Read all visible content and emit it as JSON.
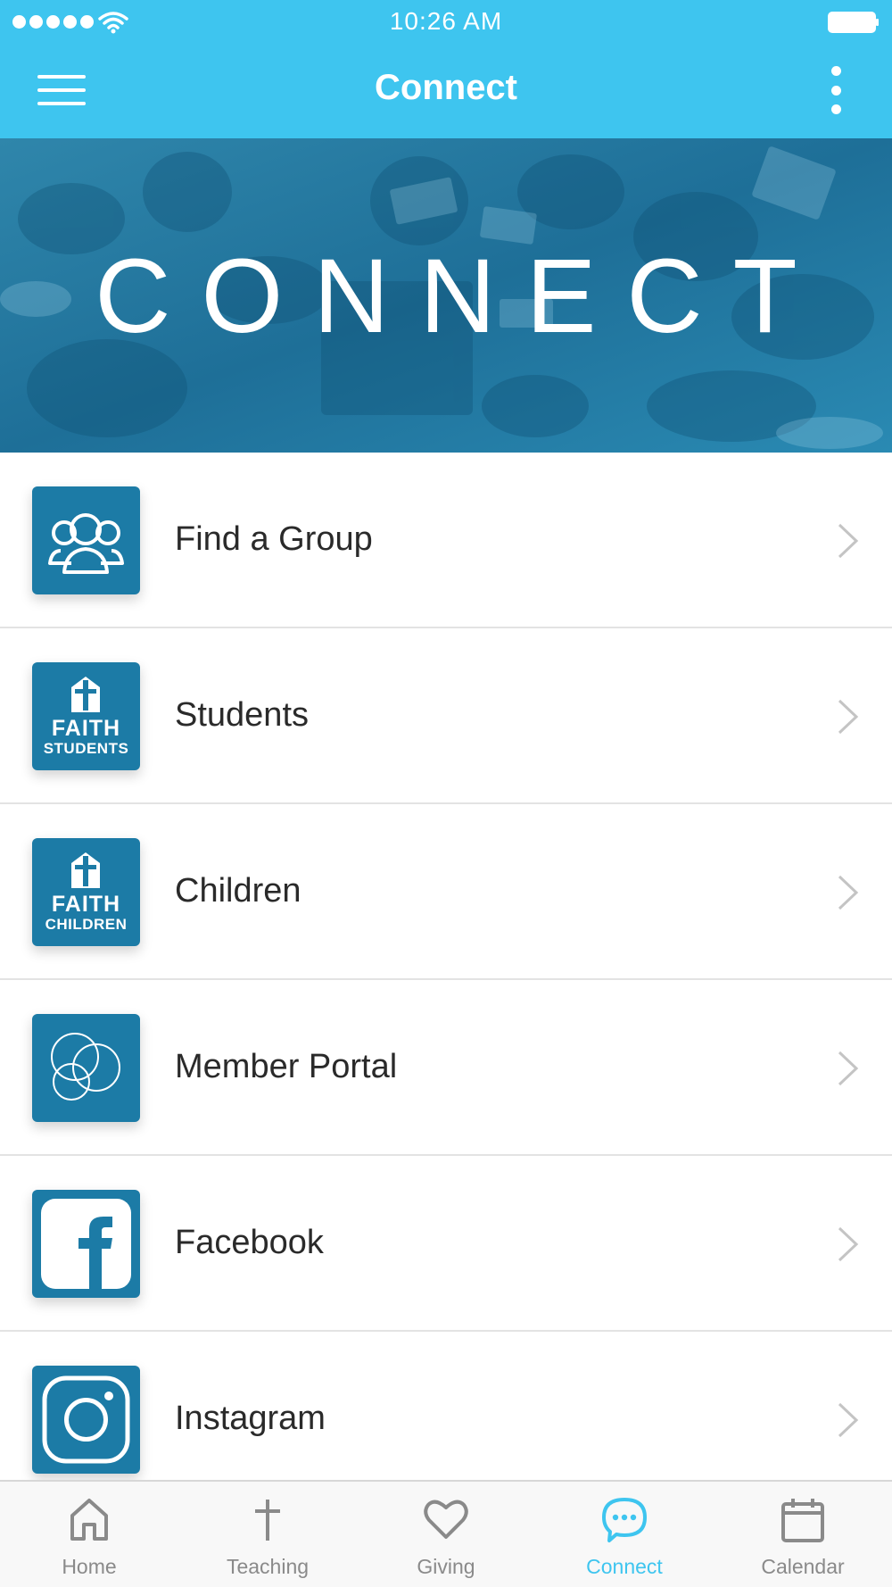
{
  "status_bar": {
    "time": "10:26 AM"
  },
  "nav_bar": {
    "title": "Connect",
    "left_icon": "hamburger-menu-icon",
    "right_icon": "more-vertical-icon"
  },
  "hero": {
    "title": "CONNECT"
  },
  "list": {
    "items": [
      {
        "label": "Find a Group",
        "icon": "group-people-icon"
      },
      {
        "label": "Students",
        "icon": "faith-students-logo",
        "logo_text": [
          "FAITH",
          "STUDENTS"
        ]
      },
      {
        "label": "Children",
        "icon": "faith-children-logo",
        "logo_text": [
          "FAITH",
          "CHILDREN"
        ]
      },
      {
        "label": "Member Portal",
        "icon": "circles-icon"
      },
      {
        "label": "Facebook",
        "icon": "facebook-icon"
      },
      {
        "label": "Instagram",
        "icon": "instagram-icon"
      }
    ]
  },
  "tab_bar": {
    "active": "Connect",
    "tabs": [
      {
        "label": "Home",
        "icon": "home-icon"
      },
      {
        "label": "Teaching",
        "icon": "cross-icon"
      },
      {
        "label": "Giving",
        "icon": "heart-icon"
      },
      {
        "label": "Connect",
        "icon": "chat-bubble-icon"
      },
      {
        "label": "Calendar",
        "icon": "calendar-icon"
      }
    ]
  },
  "colors": {
    "primary": "#3ec5ef",
    "thumb_background": "#1c7ba6",
    "hero_overlay": "#1e7aa3",
    "text": "#2a2a2a",
    "inactive_tab": "#8a8a8a",
    "divider": "#e3e3e3"
  }
}
